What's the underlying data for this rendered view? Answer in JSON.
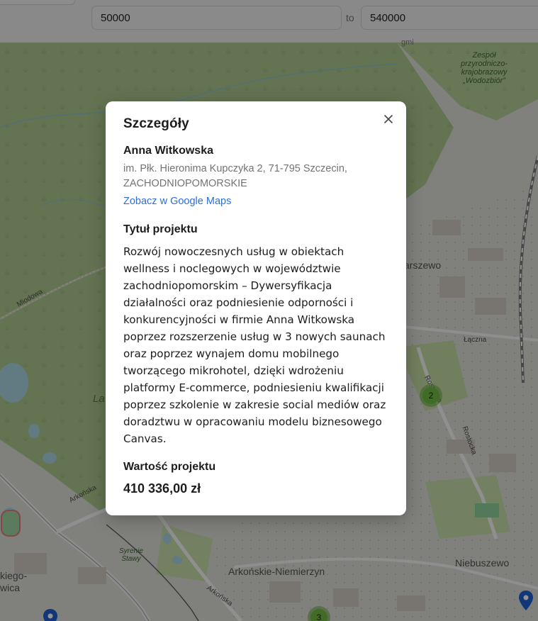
{
  "filters": {
    "price_from": "50000",
    "separator": "to",
    "price_to": "540000"
  },
  "map": {
    "labels": {
      "reserve": "Zespół\nprzyrodniczo-\nkrajobrazowy\n„Wodozbiór”",
      "district_warszewo": "arszewo",
      "street_laczna": "Łączna",
      "street_rostocka_1": "Rostocka",
      "street_rostocka_2": "Rostocka",
      "street_miodowa": "Miodowa",
      "street_arkonska_1": "Arkońska",
      "street_arkonska_2": "Arkońska",
      "park_syrenie_stawy": "Syrenie\nStawy",
      "district_arkonskie": "Arkońskie-Niemierzyn",
      "district_niebuszewo": "Niebuszewo",
      "edge_left": "kiego-\nwica",
      "forest_partial": "La",
      "top_partial": "gmi"
    },
    "clusters": [
      {
        "count": "2"
      },
      {
        "count": "3"
      }
    ],
    "colors": {
      "forest": "#a8c48a",
      "urban": "#d8d8d4",
      "water": "#aad3df",
      "cluster": "#6eba3c",
      "pin": "#1f5fcf"
    }
  },
  "modal": {
    "title": "Szczegóły",
    "name": "Anna Witkowska",
    "address": "im. Płk. Hieronima Kupczyka 2, 71-795 Szczecin, ZACHODNIOPOMORSKIE",
    "maps_link": "Zobacz w Google Maps",
    "project_title_label": "Tytuł projektu",
    "project_title": "Rozwój nowoczesnych usług w obiektach wellness i noclegowych w województwie zachodniopomorskim – Dywersyfikacja działalności oraz podniesienie odporności i konkurencyjności w firmie Anna Witkowska poprzez rozszerzenie usług w 3 nowych saunach oraz poprzez wynajem domu mobilnego tworzącego mikrohotel, dzięki wdrożeniu platformy E-commerce, podniesieniu kwalifikacji poprzez szkolenie w zakresie social mediów oraz doradztwu w opracowaniu modelu biznesowego Canvas.",
    "value_label": "Wartość projektu",
    "value": "410 336,00 zł",
    "close_icon": "close-icon"
  }
}
